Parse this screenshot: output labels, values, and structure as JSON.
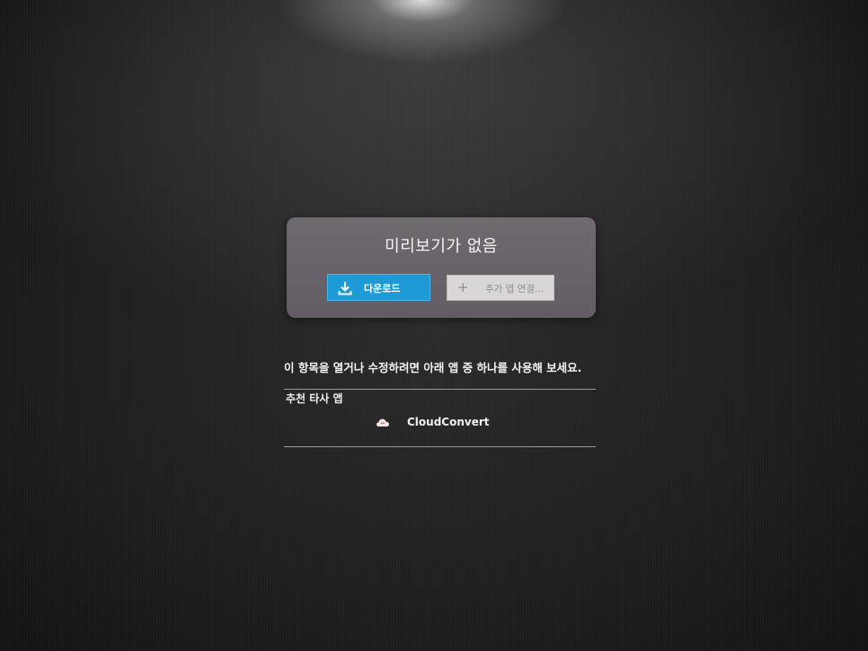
{
  "preview": {
    "title": "미리보기가 없음",
    "download_label": "다운로드",
    "download_icon": "download-icon",
    "more_apps_label": "추가 앱 연결...",
    "more_apps_icon": "plus-icon"
  },
  "instruction": "이 항목을 열거나 수정하려면 아래 앱 중 하나를 사용해 보세요.",
  "recommended": {
    "heading": "추천 타사 앱",
    "apps": [
      {
        "name": "CloudConvert",
        "icon": "cloud-icon"
      }
    ]
  },
  "colors": {
    "download_button": "#1e9bd7",
    "card_background": "#6a656b",
    "page_background": "#1c1c1c"
  }
}
